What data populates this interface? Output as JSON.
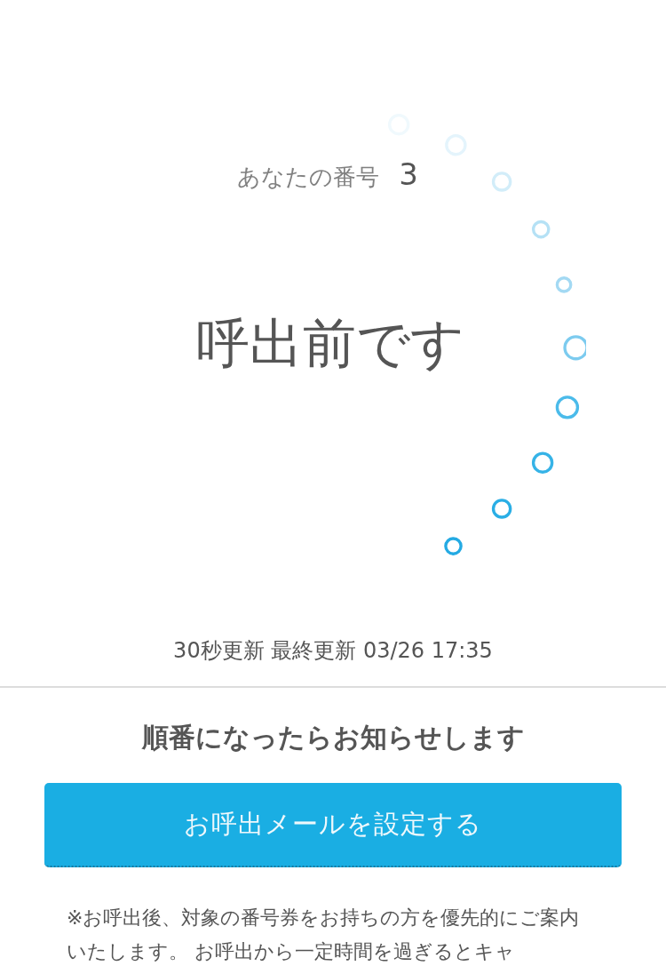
{
  "ticket": {
    "label": "あなたの番号",
    "number": "3"
  },
  "status": "呼出前です",
  "update_info": "30秒更新 最終更新 03/26 17:35",
  "notify": {
    "heading": "順番になったらお知らせします",
    "button": "お呼出メールを設定する",
    "note": "※お呼出後、対象の番号券をお持ちの方を優先的にご案内いたします。 お呼出から一定時間を過ぎるとキャ"
  }
}
